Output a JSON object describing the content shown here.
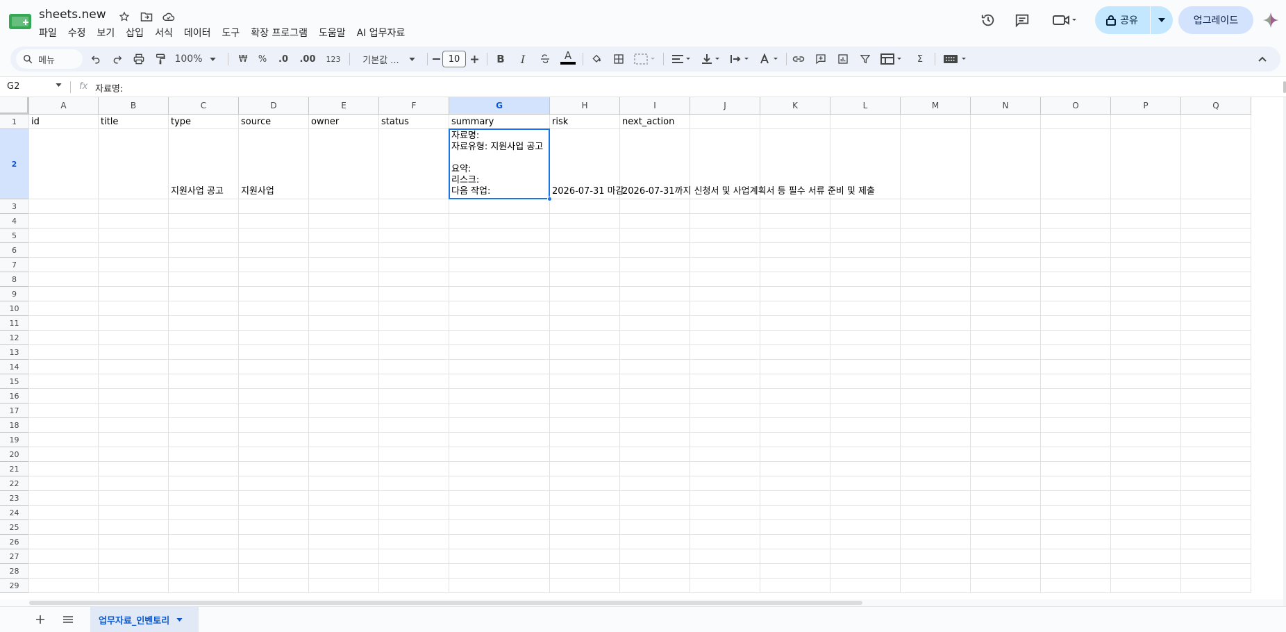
{
  "app": {
    "title": "sheets.new",
    "menu": [
      "파일",
      "수정",
      "보기",
      "삽입",
      "서식",
      "데이터",
      "도구",
      "확장 프로그램",
      "도움말",
      "AI 업무자료"
    ],
    "share_label": "공유",
    "upgrade_label": "업그레이드"
  },
  "toolbar": {
    "search_label": "메뉴",
    "zoom": "100%",
    "currency": "₩",
    "percent": "%",
    "dec_decrease": ".0",
    "dec_increase": ".00",
    "number_format": "123",
    "font": "기본값 ...",
    "font_size": "10",
    "bold": "B",
    "italic": "I",
    "text_color": "A",
    "sum": "Σ"
  },
  "formula_bar": {
    "cell_ref": "G2",
    "fx": "fx",
    "value": "자료명:"
  },
  "grid": {
    "columns": [
      "A",
      "B",
      "C",
      "D",
      "E",
      "F",
      "G",
      "H",
      "I",
      "J",
      "K",
      "L",
      "M",
      "N",
      "O",
      "P",
      "Q"
    ],
    "selected_column": "G",
    "rows": [
      "1",
      "2",
      "3",
      "4",
      "5",
      "6",
      "7",
      "8",
      "9",
      "10",
      "11",
      "12",
      "13",
      "14",
      "15",
      "16",
      "17",
      "18",
      "19",
      "20",
      "21",
      "22",
      "23",
      "24",
      "25",
      "26",
      "27",
      "28",
      "29"
    ],
    "selected_row": "2",
    "header_row": [
      "id",
      "title",
      "type",
      "source",
      "owner",
      "status",
      "summary",
      "risk",
      "next_action"
    ],
    "row2": {
      "type": "지원사업 공고",
      "source": "지원사업",
      "summary_lines": [
        "자료명:",
        "자료유형: 지원사업 공고",
        "",
        "요약:",
        "리스크:",
        "다음 작업:"
      ],
      "risk": "2026-07-31 마감",
      "next_action": "2026-07-31까지 신청서 및 사업계획서 등 필수 서류 준비 및 제출"
    }
  },
  "sheets": {
    "active": "업무자료_인벤토리"
  },
  "colors": {
    "accent": "#0b57d0",
    "selection": "#1a73e8",
    "share_bg": "#c2e7ff"
  }
}
